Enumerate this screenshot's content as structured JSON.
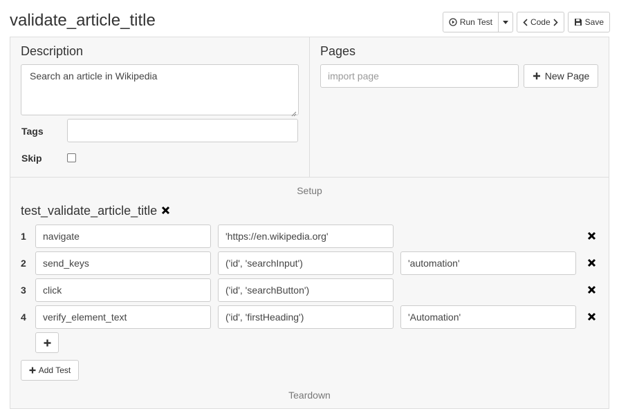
{
  "header": {
    "title": "validate_article_title",
    "run_test_label": "Run Test",
    "code_label": "Code",
    "save_label": "Save"
  },
  "description": {
    "heading": "Description",
    "text": "Search an article in Wikipedia",
    "tags_label": "Tags",
    "tags_value": "",
    "skip_label": "Skip",
    "skip_checked": false
  },
  "pages": {
    "heading": "Pages",
    "import_placeholder": "import page",
    "new_page_label": "New Page"
  },
  "setup_label": "Setup",
  "test": {
    "name": "test_validate_article_title",
    "steps": [
      {
        "num": "1",
        "action": "navigate",
        "arg1": "'https://en.wikipedia.org'",
        "arg2": null
      },
      {
        "num": "2",
        "action": "send_keys",
        "arg1": "('id', 'searchInput')",
        "arg2": "'automation'"
      },
      {
        "num": "3",
        "action": "click",
        "arg1": "('id', 'searchButton')",
        "arg2": null
      },
      {
        "num": "4",
        "action": "verify_element_text",
        "arg1": "('id', 'firstHeading')",
        "arg2": "'Automation'"
      }
    ],
    "add_test_label": "Add Test"
  },
  "teardown_label": "Teardown",
  "icons": {
    "run": "play-circle-icon",
    "dropdown": "caret-down-icon",
    "code": "chevron-left-right-icon",
    "save": "floppy-disk-icon",
    "add": "plus-icon",
    "delete": "x-icon"
  }
}
